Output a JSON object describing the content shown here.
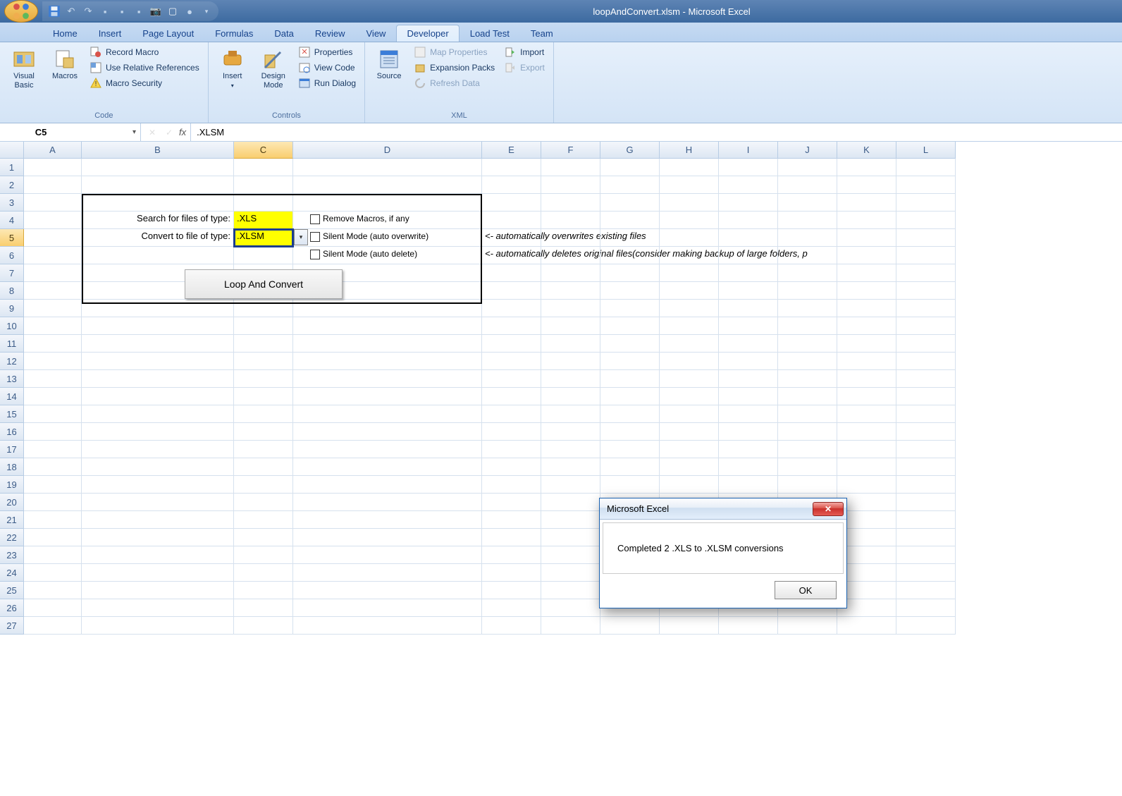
{
  "window": {
    "title": "loopAndConvert.xlsm - Microsoft Excel"
  },
  "tabs": [
    "Home",
    "Insert",
    "Page Layout",
    "Formulas",
    "Data",
    "Review",
    "View",
    "Developer",
    "Load Test",
    "Team"
  ],
  "active_tab": "Developer",
  "ribbon": {
    "code": {
      "title": "Code",
      "visual_basic": "Visual Basic",
      "macros": "Macros",
      "record_macro": "Record Macro",
      "use_relative": "Use Relative References",
      "macro_security": "Macro Security"
    },
    "controls": {
      "title": "Controls",
      "insert": "Insert",
      "design_mode": "Design Mode",
      "properties": "Properties",
      "view_code": "View Code",
      "run_dialog": "Run Dialog"
    },
    "xml": {
      "title": "XML",
      "source": "Source",
      "map_properties": "Map Properties",
      "expansion_packs": "Expansion Packs",
      "refresh_data": "Refresh Data",
      "import": "Import",
      "export": "Export"
    }
  },
  "namebox": "C5",
  "formula": ".XLSM",
  "columns": [
    "A",
    "B",
    "C",
    "D",
    "E",
    "F",
    "G",
    "H",
    "I",
    "J",
    "K",
    "L"
  ],
  "rows": 27,
  "active_col": "C",
  "active_row": 5,
  "sheet": {
    "b4": "Search for files of type:",
    "c4": ".XLS",
    "b5": "Convert to file of type:",
    "c5": ".XLSM",
    "chk1": "Remove Macros, if any",
    "chk2": "Silent Mode (auto overwrite)",
    "chk3": "Silent Mode (auto delete)",
    "note1": "<- automatically overwrites existing files",
    "note2": "<- automatically deletes original files(consider making backup of large folders, p",
    "button": "Loop And Convert"
  },
  "msgbox": {
    "title": "Microsoft Excel",
    "text": "Completed 2 .XLS to .XLSM conversions",
    "ok": "OK"
  }
}
